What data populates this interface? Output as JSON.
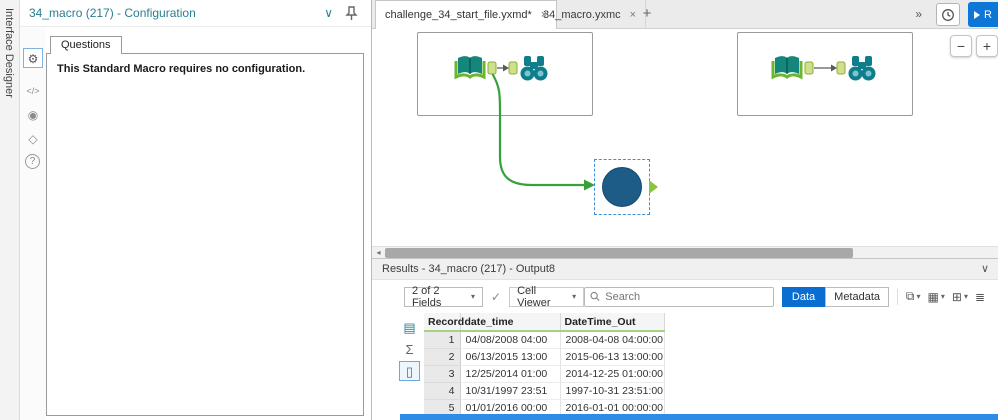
{
  "left_rail": {
    "label": "Interface Designer"
  },
  "config": {
    "title": "34_macro (217) - Configuration",
    "tab_label": "Questions",
    "message": "This Standard Macro requires no configuration."
  },
  "tabs": {
    "items": [
      {
        "label": "challenge_34_start_file.yxmd*"
      },
      {
        "label": "34_macro.yxmc"
      }
    ],
    "new_tab": "+",
    "overflow": "»"
  },
  "run": {
    "label": "R"
  },
  "zoom": {
    "out": "−",
    "in": "+"
  },
  "scrollbar": {
    "left_arrow": "◂"
  },
  "results": {
    "title": "Results - 34_macro (217) - Output8",
    "fields_label": "2 of 2 Fields",
    "cell_viewer_label": "Cell Viewer",
    "search_placeholder": "Search",
    "data_label": "Data",
    "metadata_label": "Metadata",
    "table": {
      "columns": [
        "Record",
        "date_time",
        "DateTime_Out"
      ],
      "rows": [
        [
          "1",
          "04/08/2008 04:00",
          "2008-04-08 04:00:00"
        ],
        [
          "2",
          "06/13/2015 13:00",
          "2015-06-13 13:00:00"
        ],
        [
          "3",
          "12/25/2014 01:00",
          "2014-12-25 01:00:00"
        ],
        [
          "4",
          "10/31/1997 23:51",
          "1997-10-31 23:51:00"
        ],
        [
          "5",
          "01/01/2016 00:00",
          "2016-01-01 00:00:00"
        ]
      ]
    }
  },
  "icons": {
    "gear": "⚙",
    "code": "</>",
    "eye": "◉",
    "tag": "◇",
    "help": "?",
    "chevron_down": "∨",
    "close": "×",
    "check": "✓",
    "caret_down": "▾",
    "copy": "⧉",
    "grid": "▦",
    "export": "⊞",
    "menu": "≣",
    "table_view": "▤",
    "sigma": "Σ",
    "page": "▯"
  },
  "colors": {
    "accent_blue": "#0d76d6",
    "teal": "#2a7e92",
    "wire_green": "#35a13b",
    "header_green": "#a6d184",
    "macro_blue": "#1d5c87"
  }
}
